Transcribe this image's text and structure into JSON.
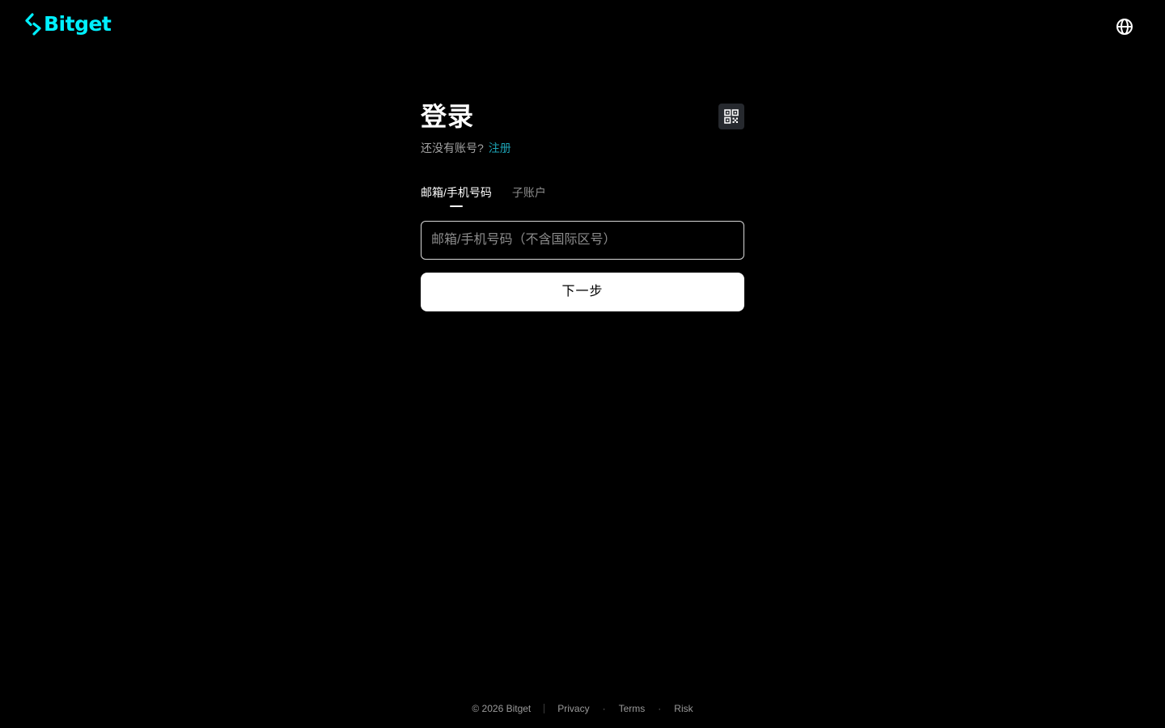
{
  "header": {
    "logo_text": "Bitget",
    "logo_icon": "bitget-arrow-icon",
    "language_icon": "globe-icon"
  },
  "login": {
    "title": "登录",
    "no_account_text": "还没有账号?",
    "signup_link": "注册",
    "qr_icon": "qr-code-icon",
    "tabs": [
      {
        "label": "邮箱/手机号码",
        "active": true
      },
      {
        "label": "子账户",
        "active": false
      }
    ],
    "account_input": {
      "value": "",
      "placeholder": "邮箱/手机号码（不含国际区号）"
    },
    "next_button": "下一步"
  },
  "footer": {
    "copyright": "© 2026 Bitget",
    "links": [
      "Privacy",
      "Terms",
      "Risk"
    ]
  },
  "colors": {
    "background": "#000000",
    "brand_accent": "#00f0ff",
    "link": "#1da2b4",
    "button_bg": "#ffffff",
    "qr_button_bg": "#26292e"
  }
}
